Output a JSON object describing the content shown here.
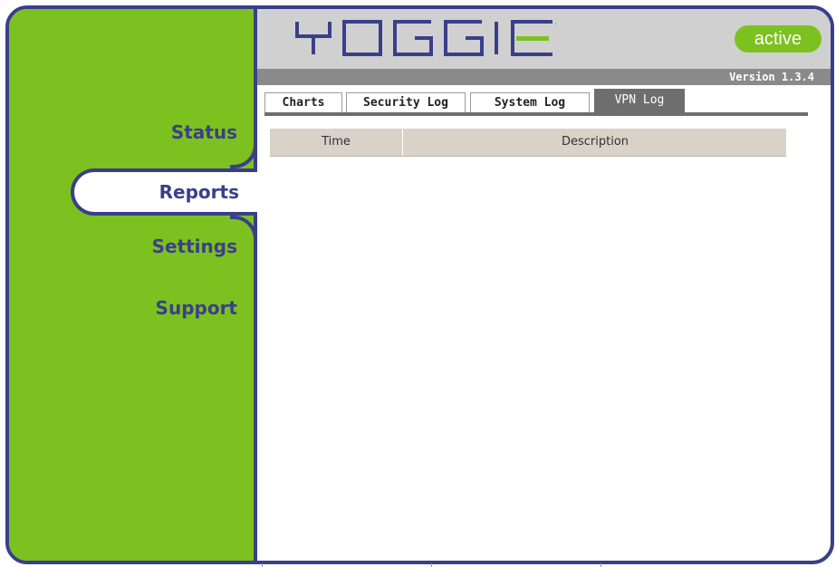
{
  "header": {
    "logo_text": "YOGGIE",
    "status_badge": "active",
    "version": "Version 1.3.4"
  },
  "sidebar": {
    "items": [
      {
        "label": "Status"
      },
      {
        "label": "Reports",
        "selected": true
      },
      {
        "label": "Settings"
      },
      {
        "label": "Support"
      }
    ]
  },
  "tabs": [
    {
      "label": "Charts"
    },
    {
      "label": "Security Log"
    },
    {
      "label": "System Log"
    },
    {
      "label": "VPN Log",
      "selected": true
    }
  ],
  "table": {
    "columns": [
      "Time",
      "Description"
    ],
    "rows": []
  },
  "colors": {
    "brand_green": "#7cc11f",
    "border_navy": "#3a3f8a",
    "header_gray": "#d0d0d0"
  }
}
